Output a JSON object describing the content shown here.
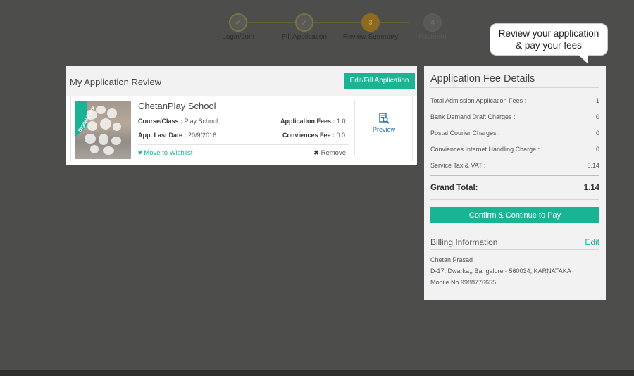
{
  "stepper": {
    "steps": [
      {
        "label": "Login/Join",
        "mark": "✔"
      },
      {
        "label": "Fill Application",
        "mark": "✔"
      },
      {
        "label": "Review Summary",
        "mark": "3"
      },
      {
        "label": "Payment",
        "mark": "4"
      }
    ]
  },
  "tooltip": {
    "line1": "Review your application",
    "line2": "& pay your fees"
  },
  "review": {
    "title": "My Application Review",
    "edit_button": "Edit/Fill Application",
    "ribbon": "Digital Form",
    "school_name": "ChetanPlay School",
    "course_label": "Course/Class :",
    "course_value": "Play School",
    "last_date_label": "App. Last Date :",
    "last_date_value": "20/9/2016",
    "app_fees_label": "Application Fees :",
    "app_fees_value": "1.0",
    "conv_fee_label": "Conviences Fee :",
    "conv_fee_value": "0.0",
    "wishlist": "Move to Wishlist",
    "remove": "Remove",
    "preview": "Preview"
  },
  "fees": {
    "title": "Application Fee Details",
    "rows": [
      {
        "label": "Total Admission Application Fees :",
        "value": "1"
      },
      {
        "label": "Bank Demand Draft Charges :",
        "value": "0"
      },
      {
        "label": "Postal Courier Charges :",
        "value": "0"
      },
      {
        "label": "Conviences Internet Handling Charge :",
        "value": "0"
      },
      {
        "label": "Service Tax & VAT :",
        "value": "0.14"
      }
    ],
    "grand_label": "Grand Total:",
    "grand_value": "1.14",
    "confirm_button": "Confirm & Continue to Pay"
  },
  "billing": {
    "title": "Billing Information",
    "edit": "Edit",
    "name": "Chetan Prasad",
    "address": "D-17, Dwarka,, Bangalore - 560034, KARNATAKA",
    "mobile": "Mobile No 9988776655"
  },
  "colors": {
    "accent": "#1ab394",
    "overlay": "#4d4e4c",
    "step_active": "#8d6a1f"
  }
}
